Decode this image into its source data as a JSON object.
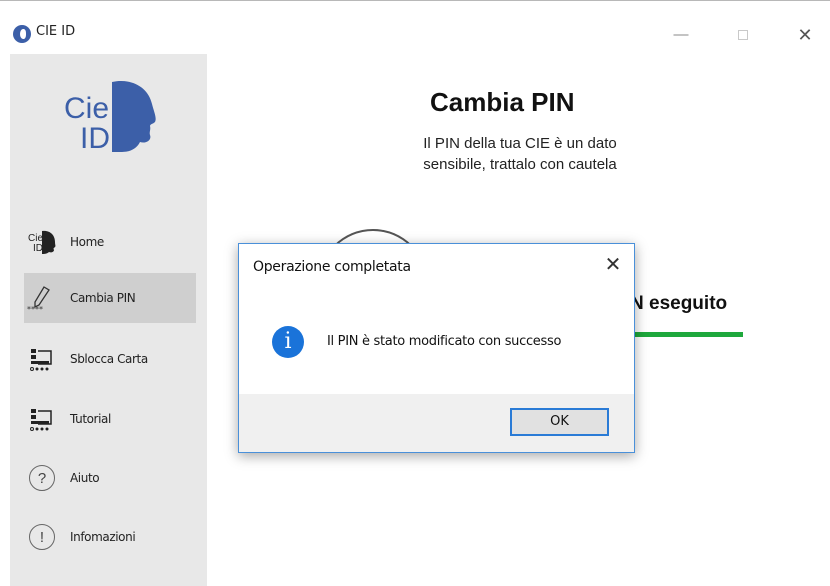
{
  "window": {
    "title": "CIE ID",
    "minimize_glyph": "—",
    "close_glyph": "✕"
  },
  "sidebar": {
    "logo_text_top": "Cie",
    "logo_text_bottom": "ID",
    "items": [
      {
        "label": "Home",
        "icon": "cie-id-icon"
      },
      {
        "label": "Cambia PIN",
        "icon": "pencil-icon",
        "active": true,
        "icon_caption": "****"
      },
      {
        "label": "Sblocca Carta",
        "icon": "card-unlock-icon"
      },
      {
        "label": "Tutorial",
        "icon": "tutorial-icon"
      },
      {
        "label": "Aiuto",
        "icon": "help-icon",
        "glyph": "?"
      },
      {
        "label": "Infomazioni",
        "icon": "info-icon",
        "glyph": "!"
      }
    ]
  },
  "main": {
    "title": "Cambia PIN",
    "subtitle_line1": "Il PIN della tua CIE è un dato",
    "subtitle_line2": "sensibile,  trattalo con cautela",
    "status_partial": "N eseguito"
  },
  "dialog": {
    "title": "Operazione completata",
    "close_glyph": "✕",
    "icon_glyph": "i",
    "message": "Il PIN è stato modificato con successo",
    "ok_label": "OK"
  },
  "colors": {
    "accent": "#3c5fa8",
    "sidebar_bg": "#e8e8e8",
    "active_item_bg": "#cfcfcf",
    "success_bar": "#1ea83c",
    "info_blue": "#1a73d9",
    "dialog_border": "#4a90d9"
  }
}
